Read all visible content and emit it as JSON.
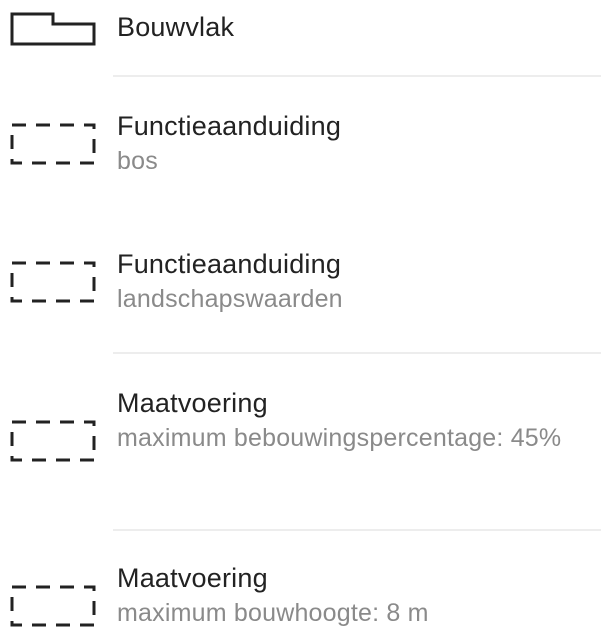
{
  "legend": {
    "items": [
      {
        "icon": "bouwvlak-outline-icon",
        "title": "Bouwvlak",
        "subtitle": ""
      },
      {
        "icon": "dashed-rectangle-icon",
        "title": "Functieaanduiding",
        "subtitle": "bos"
      },
      {
        "icon": "dashed-rectangle-icon",
        "title": "Functieaanduiding",
        "subtitle": "landschapswaarden"
      },
      {
        "icon": "dashed-rectangle-icon",
        "title": "Maatvoering",
        "subtitle": "maximum bebouwingspercentage: 45%"
      },
      {
        "icon": "dashed-rectangle-icon",
        "title": "Maatvoering",
        "subtitle": "maximum bouwhoogte: 8 m"
      }
    ]
  }
}
